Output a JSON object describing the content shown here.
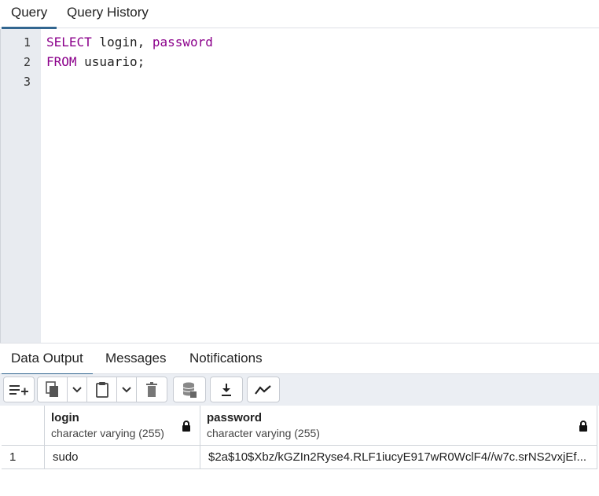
{
  "top_tabs": [
    {
      "label": "Query",
      "active": true
    },
    {
      "label": "Query History",
      "active": false
    }
  ],
  "editor": {
    "line_numbers": [
      "1",
      "2",
      "3"
    ],
    "lines": [
      {
        "tokens": [
          {
            "text": "SELECT",
            "kind": "keyword"
          },
          {
            "text": " login, ",
            "kind": "plain"
          },
          {
            "text": "password",
            "kind": "keyword"
          }
        ]
      },
      {
        "tokens": [
          {
            "text": "FROM",
            "kind": "keyword"
          },
          {
            "text": " usuario;",
            "kind": "plain"
          }
        ]
      },
      {
        "tokens": []
      }
    ],
    "keyword_color": "#8b008b"
  },
  "bottom_tabs": [
    {
      "label": "Data Output",
      "active": true
    },
    {
      "label": "Messages",
      "active": false
    },
    {
      "label": "Notifications",
      "active": false
    }
  ],
  "toolbar": {
    "buttons": [
      "add-row-icon",
      "copy-icon",
      "chevron-down-icon",
      "paste-icon",
      "chevron-down-icon",
      "delete-icon",
      "save-data-icon",
      "download-icon",
      "graph-icon"
    ]
  },
  "grid": {
    "columns": [
      {
        "name": "login",
        "type": "character varying (255)",
        "locked": true
      },
      {
        "name": "password",
        "type": "character varying (255)",
        "locked": true
      }
    ],
    "rows": [
      {
        "num": "1",
        "values": [
          "sudo",
          "$2a$10$Xbz/kGZIn2Ryse4.RLF1iucyE917wR0WclF4//w7c.srNS2vxjEf..."
        ]
      }
    ]
  },
  "accent_color": "#326690"
}
